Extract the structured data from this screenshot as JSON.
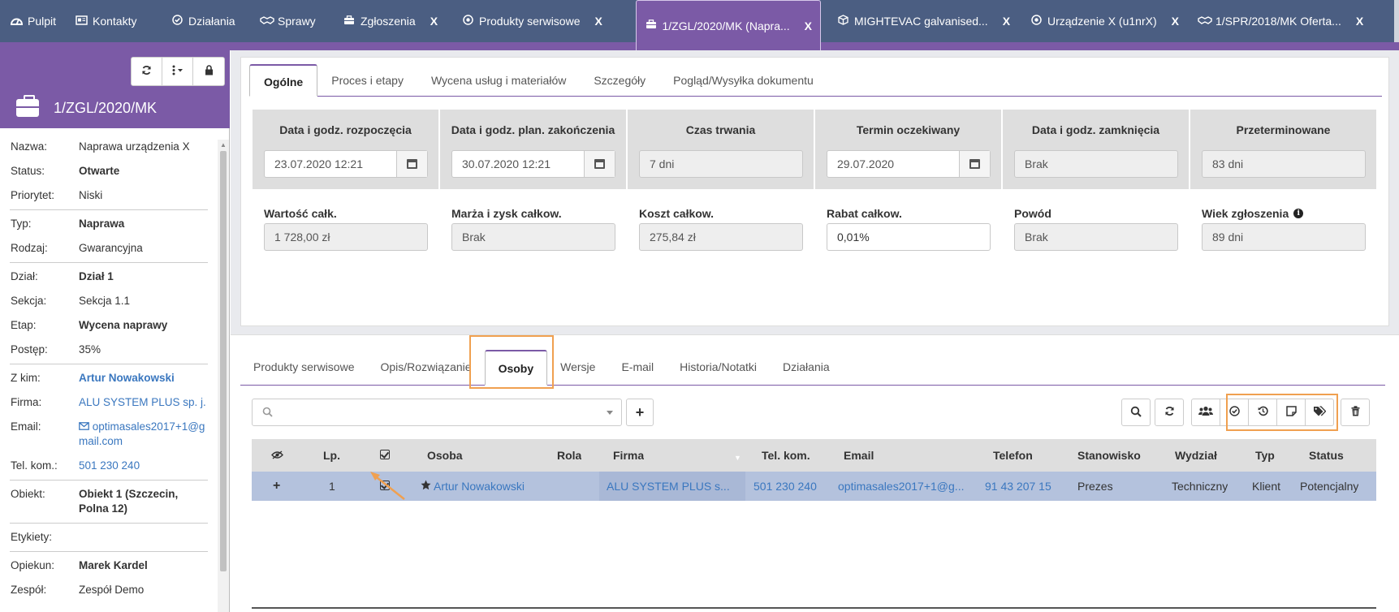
{
  "top_tabs": [
    {
      "icon": "dashboard-icon",
      "label": "Pulpit",
      "closable": false
    },
    {
      "icon": "contacts-card-icon",
      "label": "Kontakty",
      "closable": false
    },
    {
      "icon": "check-circle-icon",
      "label": "Działania",
      "closable": false
    },
    {
      "icon": "handshake-icon",
      "label": "Sprawy",
      "closable": false
    },
    {
      "icon": "briefcase-icon",
      "label": "Zgłoszenia",
      "closable": true
    },
    {
      "icon": "dot-circle-icon",
      "label": "Produkty serwisowe",
      "closable": true
    },
    {
      "icon": "briefcase-icon",
      "label": "1/ZGL/2020/MK (Napra...",
      "closable": true,
      "active": true
    },
    {
      "icon": "cube-icon",
      "label": "MIGHTEVAC galvanised...",
      "closable": true
    },
    {
      "icon": "dot-circle-icon",
      "label": "Urządzenie X (u1nrX)",
      "closable": true
    },
    {
      "icon": "handshake-icon",
      "label": "1/SPR/2018/MK Oferta...",
      "closable": true
    }
  ],
  "close_label": "X",
  "left_panel": {
    "title": "1/ZGL/2020/MK",
    "fields": {
      "nazwa": {
        "k": "Nazwa:",
        "v": "Naprawa urządzenia X"
      },
      "status": {
        "k": "Status:",
        "v": "Otwarte"
      },
      "priorytet": {
        "k": "Priorytet:",
        "v": "Niski"
      },
      "typ": {
        "k": "Typ:",
        "v": "Naprawa"
      },
      "rodzaj": {
        "k": "Rodzaj:",
        "v": "Gwarancyjna"
      },
      "dzial": {
        "k": "Dział:",
        "v": "Dział 1"
      },
      "sekcja": {
        "k": "Sekcja:",
        "v": "Sekcja 1.1"
      },
      "etap": {
        "k": "Etap:",
        "v": "Wycena naprawy"
      },
      "postep": {
        "k": "Postęp:",
        "v": "35%"
      },
      "zkim": {
        "k": "Z kim:",
        "v": "Artur Nowakowski"
      },
      "firma": {
        "k": "Firma:",
        "v": "ALU SYSTEM PLUS sp. j."
      },
      "email": {
        "k": "Email:",
        "v": "optimasales2017+1@gmail.com"
      },
      "telkom": {
        "k": "Tel. kom.:",
        "v": "501 230 240"
      },
      "obiekt": {
        "k": "Obiekt:",
        "v": "Obiekt 1 (Szczecin, Polna 12)"
      },
      "etykiety": {
        "k": "Etykiety:",
        "v": ""
      },
      "opiekun": {
        "k": "Opiekun:",
        "v": "Marek Kardel"
      },
      "zespol": {
        "k": "Zespół:",
        "v": "Zespół Demo"
      }
    }
  },
  "main_tabs": [
    "Ogólne",
    "Proces i etapy",
    "Wycena usług i materiałów",
    "Szczegóły",
    "Pogląd/Wysyłka dokumentu"
  ],
  "general": {
    "start": {
      "label": "Data i godz. rozpoczęcia",
      "value": "23.07.2020 12:21"
    },
    "planned_end": {
      "label": "Data i godz. plan. zakończenia",
      "value": "30.07.2020 12:21"
    },
    "duration": {
      "label": "Czas trwania",
      "value": "7 dni"
    },
    "expected": {
      "label": "Termin oczekiwany",
      "value": "29.07.2020"
    },
    "closed": {
      "label": "Data i godz. zamknięcia",
      "value": "Brak"
    },
    "overdue": {
      "label": "Przeterminowane",
      "value": "83 dni"
    },
    "total_value": {
      "label": "Wartość całk.",
      "value": "1 728,00 zł"
    },
    "margin": {
      "label": "Marża i zysk całkow.",
      "value": "Brak"
    },
    "total_cost": {
      "label": "Koszt całkow.",
      "value": "275,84 zł"
    },
    "discount": {
      "label": "Rabat całkow.",
      "value": "0,01%"
    },
    "reason": {
      "label": "Powód",
      "value": "Brak"
    },
    "age": {
      "label": "Wiek zgłoszenia",
      "value": "89 dni"
    }
  },
  "sub_tabs": [
    "Produkty serwisowe",
    "Opis/Rozwiązanie",
    "Osoby",
    "Wersje",
    "E-mail",
    "Historia/Notatki",
    "Działania"
  ],
  "table": {
    "headers": {
      "lp": "Lp.",
      "osoba": "Osoba",
      "rola": "Rola",
      "firma": "Firma",
      "telkom": "Tel. kom.",
      "email": "Email",
      "telefon": "Telefon",
      "stanowisko": "Stanowisko",
      "wydzial": "Wydział",
      "typ": "Typ",
      "status": "Status"
    },
    "rows": [
      {
        "lp": "1",
        "osoba": "Artur Nowakowski",
        "rola": "",
        "firma": "ALU SYSTEM PLUS s...",
        "telkom": "501 230 240",
        "email": "optimasales2017+1@g...",
        "telefon": "91 43 207 15",
        "stanowisko": "Prezes",
        "wydzial": "Techniczny",
        "typ": "Klient",
        "status": "Potencjalny"
      }
    ]
  },
  "colors": {
    "topbar": "#4b5e82",
    "accent": "#7b5aa6",
    "highlight": "#f0a050",
    "row_selected": "#b4c2dd",
    "link": "#3a77bf"
  }
}
